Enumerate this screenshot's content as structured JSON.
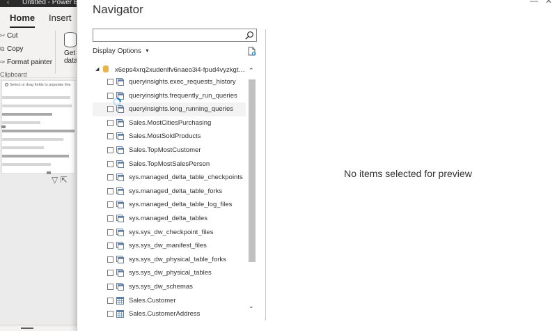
{
  "app": {
    "title": "Untitled - Power BI",
    "tabs": [
      "Home",
      "Insert"
    ],
    "clipboard": {
      "cut": "Cut",
      "copy": "Copy",
      "format_painter": "Format painter",
      "group_label": "Clipboard"
    },
    "get_data": {
      "line1": "Get",
      "line2": "data"
    },
    "canvas_hint": "Select or drag fields to populate this"
  },
  "navigator": {
    "title": "Navigator",
    "search": {
      "value": "",
      "placeholder": ""
    },
    "display_options": "Display Options",
    "root": "x6eps4xrq2xudenlfv6naeo3i4-fpud4vyzkgtu...",
    "items": [
      {
        "label": "queryinsights.exec_requests_history",
        "icon": "view-icon"
      },
      {
        "label": "queryinsights.frequently_run_queries",
        "icon": "view-icon"
      },
      {
        "label": "queryinsights.long_running_queries",
        "icon": "view-icon"
      },
      {
        "label": "Sales.MostCitiesPurchasing",
        "icon": "view-icon"
      },
      {
        "label": "Sales.MostSoldProducts",
        "icon": "view-icon"
      },
      {
        "label": "Sales.TopMostCustomer",
        "icon": "view-icon"
      },
      {
        "label": "Sales.TopMostSalesPerson",
        "icon": "view-icon"
      },
      {
        "label": "sys.managed_delta_table_checkpoints",
        "icon": "view-icon"
      },
      {
        "label": "sys.managed_delta_table_forks",
        "icon": "view-icon"
      },
      {
        "label": "sys.managed_delta_table_log_files",
        "icon": "view-icon"
      },
      {
        "label": "sys.managed_delta_tables",
        "icon": "view-icon"
      },
      {
        "label": "sys.sys_dw_checkpoint_files",
        "icon": "view-icon"
      },
      {
        "label": "sys.sys_dw_manifest_files",
        "icon": "view-icon"
      },
      {
        "label": "sys.sys_dw_physical_table_forks",
        "icon": "view-icon"
      },
      {
        "label": "sys.sys_dw_physical_tables",
        "icon": "view-icon"
      },
      {
        "label": "sys.sys_dw_schemas",
        "icon": "view-icon"
      },
      {
        "label": "Sales.Customer",
        "icon": "table-icon"
      },
      {
        "label": "Sales.CustomerAddress",
        "icon": "table-icon"
      }
    ],
    "preview_empty": "No items selected for preview"
  },
  "colors": {
    "accent": "#0078d4",
    "table_icon": "#5b7fa8",
    "db_icon": "#e8b54b",
    "titlebar": "#2b2b2b"
  }
}
